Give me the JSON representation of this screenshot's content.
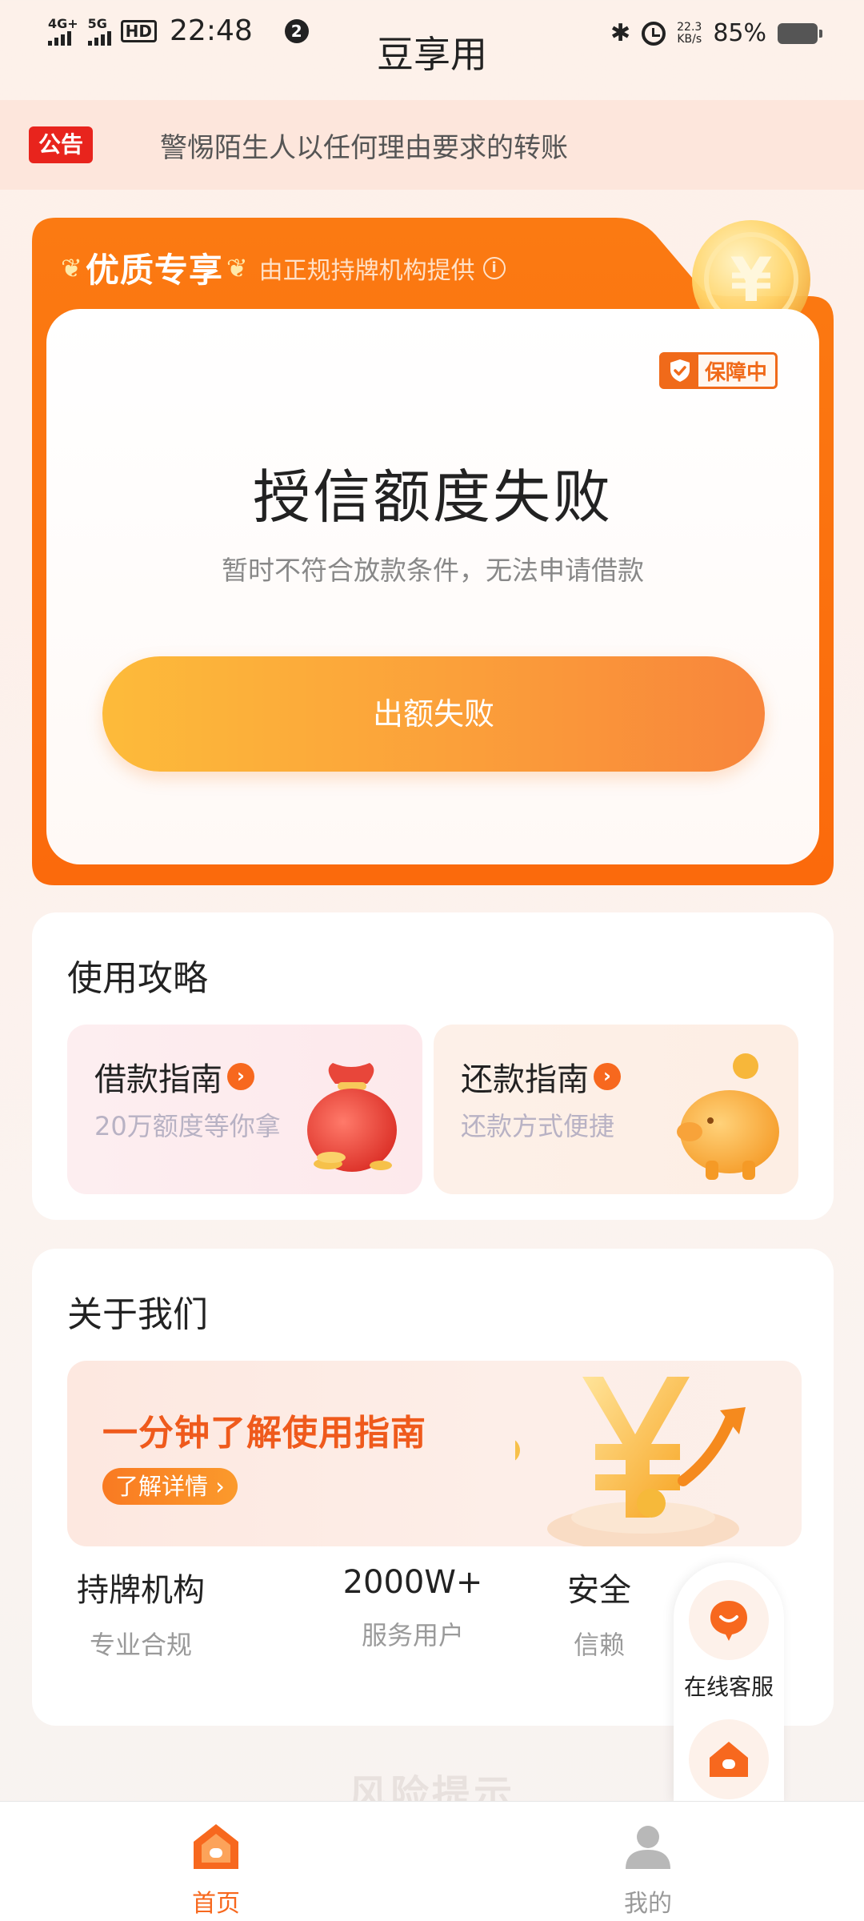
{
  "status_bar": {
    "signal_1": "4G+",
    "signal_2": "5G",
    "hd": "HD",
    "time": "22:48",
    "notification_count": "2",
    "net_speed": "22.3",
    "net_speed_unit": "KB/s",
    "battery": "85%"
  },
  "app": {
    "title": "豆享用"
  },
  "notice": {
    "tag": "公告",
    "text": "警惕陌生人以任何理由要求的转账"
  },
  "hero": {
    "title": "优质专享",
    "subtitle": "由正规持牌机构提供",
    "badge": "保障中",
    "status_title": "授信额度失败",
    "status_desc": "暂时不符合放款条件，无法申请借款",
    "button": "出额失败"
  },
  "guide": {
    "title": "使用攻略",
    "items": [
      {
        "title": "借款指南",
        "subtitle": "20万额度等你拿"
      },
      {
        "title": "还款指南",
        "subtitle": "还款方式便捷"
      }
    ]
  },
  "about": {
    "title": "关于我们",
    "banner_title": "一分钟了解使用指南",
    "banner_button": "了解详情",
    "stats": [
      {
        "value": "持牌机构",
        "label": "专业合规"
      },
      {
        "value": "2000W+",
        "label": "服务用户"
      },
      {
        "value": "安全",
        "label": "信赖"
      }
    ]
  },
  "floating": {
    "service_label": "在线客服"
  },
  "risk_title": "风险提示",
  "tabbar": {
    "items": [
      {
        "label": "首页",
        "active": true
      },
      {
        "label": "我的",
        "active": false
      }
    ]
  },
  "colors": {
    "accent": "#f7681e",
    "primary_orange": "#fb8a1f",
    "notice_red": "#e8241d"
  }
}
